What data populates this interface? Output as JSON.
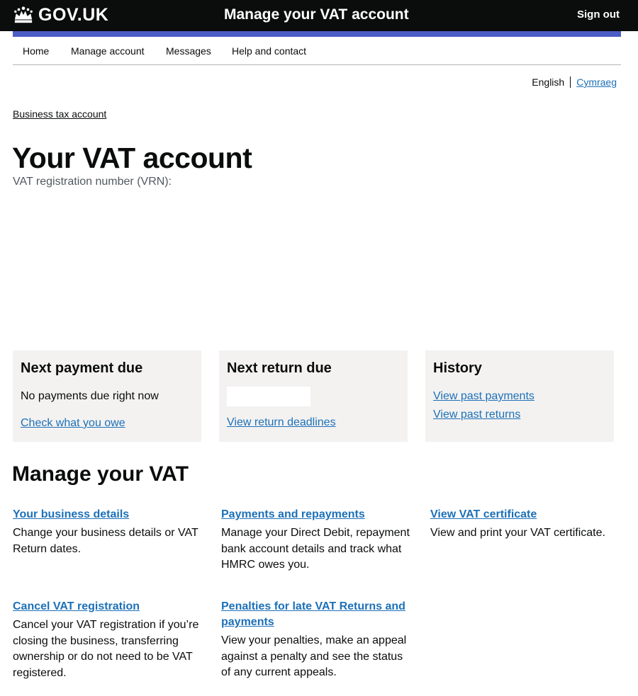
{
  "header": {
    "logo_text": "GOV.UK",
    "service_name": "Manage your VAT account",
    "sign_out": "Sign out"
  },
  "nav": {
    "items": [
      {
        "label": "Home"
      },
      {
        "label": "Manage account"
      },
      {
        "label": "Messages"
      },
      {
        "label": "Help and contact"
      }
    ]
  },
  "language": {
    "current": "English",
    "other": "Cymraeg"
  },
  "breadcrumb": "Business tax account",
  "page": {
    "title": "Your VAT account",
    "vrn_label": "VAT registration number (VRN):"
  },
  "cards": [
    {
      "title": "Next payment due",
      "text": "No payments due right now",
      "links": [
        "Check what you owe"
      ]
    },
    {
      "title": "Next return due",
      "links": [
        "View return deadlines"
      ]
    },
    {
      "title": "History",
      "links": [
        "View past payments",
        "View past returns"
      ]
    }
  ],
  "manage": {
    "title": "Manage your VAT",
    "tiles": [
      {
        "link": "Your business details",
        "desc": "Change your business details or VAT Return dates."
      },
      {
        "link": "Payments and repayments",
        "desc": "Manage your Direct Debit, repayment bank account details and track what HMRC owes you."
      },
      {
        "link": "View VAT certificate",
        "desc": "View and print your VAT certificate."
      },
      {
        "link": "Cancel VAT registration",
        "desc": "Cancel your VAT registration if you’re closing the business, transferring ownership or do not need to be VAT registered."
      },
      {
        "link": "Penalties for late VAT Returns and payments",
        "desc": "View your penalties, make an appeal against a penalty and see the status of any current appeals."
      }
    ]
  },
  "colors": {
    "header_bg": "#0b0c0c",
    "accent_bar": "#4c5cc5",
    "link": "#1d70b8",
    "card_bg": "#f3f2f1"
  },
  "icons": {
    "logo": "crown-icon"
  }
}
